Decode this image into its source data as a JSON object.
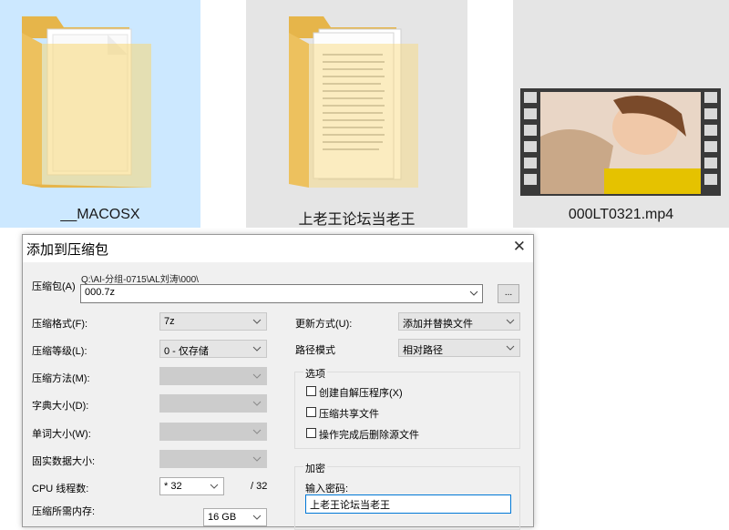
{
  "explorer": {
    "items": [
      {
        "label": "__MACOSX",
        "icon": "folder-icon",
        "selected": true
      },
      {
        "label": "上老王论坛当老王",
        "icon": "folder-icon",
        "selected": false
      },
      {
        "label": "000LT0321.mp4",
        "icon": "video-thumbnail",
        "selected": false
      }
    ]
  },
  "dialog": {
    "title": "添加到压缩包",
    "archive_label": "压缩包(A)",
    "archive_path": "Q:\\AI-分组-0715\\AL刘涛\\000\\",
    "archive_name": "000.7z",
    "browse_label": "...",
    "left_fields": [
      {
        "label": "压缩格式(F):",
        "value": "7z"
      },
      {
        "label": "压缩等级(L):",
        "value": "0 - 仅存储"
      },
      {
        "label": "压缩方法(M):",
        "value": ""
      },
      {
        "label": "字典大小(D):",
        "value": ""
      },
      {
        "label": "单词大小(W):",
        "value": ""
      },
      {
        "label": "固实数据大小:",
        "value": ""
      }
    ],
    "threads_label": "CPU 线程数:",
    "threads_value": "* 32",
    "threads_total": "/ 32",
    "memory_label": "压缩所需内存:",
    "memory_value": "16 GB",
    "update_label": "更新方式(U):",
    "update_value": "添加并替换文件",
    "path_mode_label": "路径模式",
    "path_mode_value": "相对路径",
    "options_title": "选项",
    "options": [
      {
        "label": "创建自解压程序(X)",
        "checked": false
      },
      {
        "label": "压缩共享文件",
        "checked": false
      },
      {
        "label": "操作完成后删除源文件",
        "checked": false
      }
    ],
    "encrypt_title": "加密",
    "password_label": "输入密码:",
    "password_value": "上老王论坛当老王"
  }
}
